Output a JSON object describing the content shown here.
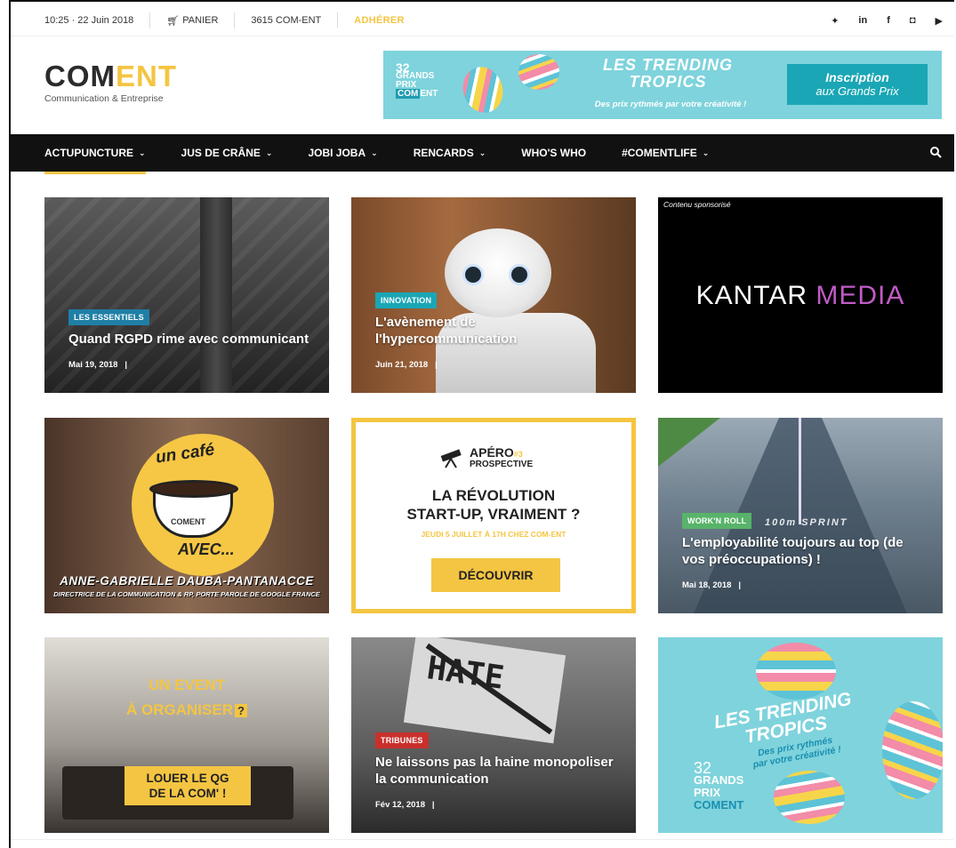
{
  "topbar": {
    "datetime": "10:25 · 22 Juin 2018",
    "cart": "PANIER",
    "minitel": "3615 COM-ENT",
    "join": "ADHÉRER",
    "socials": [
      "twitter-icon",
      "linkedin-icon",
      "facebook-icon",
      "instagram-icon",
      "youtube-icon"
    ],
    "social_glyphs": [
      "✦",
      "in",
      "f",
      "◘",
      "▶"
    ]
  },
  "logo": {
    "com": "COM",
    "ent": "ENT",
    "subtitle": "Communication & Entreprise"
  },
  "banner": {
    "gp_number": "32",
    "gp_line1": "GRANDS",
    "gp_line2": "PRIX",
    "gp_com": "COM",
    "gp_ent": "ENT",
    "title_line1": "LES TRENDING",
    "title_line2": "TROPICS",
    "tagline": "Des prix rythmés par votre créativité !",
    "cta_line1": "Inscription",
    "cta_line2": "aux Grands Prix"
  },
  "nav": {
    "items": [
      {
        "label": "ACTUPUNCTURE",
        "dropdown": true
      },
      {
        "label": "JUS DE CRÂNE",
        "dropdown": true
      },
      {
        "label": "JOBI JOBA",
        "dropdown": true
      },
      {
        "label": "RENCARDS",
        "dropdown": true
      },
      {
        "label": "WHO'S WHO",
        "dropdown": false
      },
      {
        "label": "#COMENTLIFE",
        "dropdown": true
      }
    ],
    "chevron": "⌄"
  },
  "cards": {
    "c1": {
      "badge": "LES ESSENTIELS",
      "title": "Quand RGPD rime avec communicant",
      "date": "Mai 19, 2018",
      "sep": "|"
    },
    "c2": {
      "badge": "INNOVATION",
      "title": "L'avènement de l'hypercommunication",
      "date": "Juin 21, 2018",
      "sep": "|"
    },
    "c3": {
      "sponsor": "Contenu sponsorisé",
      "brand1": "KANTAR",
      "brand2": "MEDIA"
    },
    "c4": {
      "un_cafe": "un café",
      "cup_label": "COMENT",
      "avec": "AVEC...",
      "name": "ANNE-GABRIELLE DAUBA-PANTANACCE",
      "role": "DIRECTRICE DE LA COMMUNICATION & RP, PORTE PAROLE DE GOOGLE FRANCE"
    },
    "c5": {
      "apero": "APÉRO",
      "apero_num": "#3",
      "prospective": "PROSPECTIVE",
      "headline1": "LA RÉVOLUTION",
      "headline2": "START-UP, VRAIMENT ?",
      "when": "JEUDI 5 JUILLET À 17H CHEZ COM-ENT",
      "button": "DÉCOUVRIR"
    },
    "c6": {
      "badge": "WORK'N ROLL",
      "title": "L'employabilité toujours au top (de vos préoccupations) !",
      "date": "Mai 18, 2018",
      "sep": "|",
      "track_text": "100m SPRINT"
    },
    "c7": {
      "line1": "UN EVENT",
      "line2": "À ORGANISER",
      "qmark": "?",
      "cta1": "LOUER LE QG",
      "cta2": "DE LA COM' !"
    },
    "c8": {
      "badge": "TRIBUNES",
      "title": "Ne laissons pas la haine monopoliser la communication",
      "date": "Fév 12, 2018",
      "sep": "|",
      "sign": "HATE"
    },
    "c9": {
      "title1": "LES TRENDING",
      "title2": "TROPICS",
      "tag1": "Des prix rythmés",
      "tag2": "par votre créativité !",
      "gp_number": "32",
      "gp1": "GRANDS",
      "gp2": "PRIX",
      "gp_com": "COMENT"
    }
  },
  "colors": {
    "accent": "#f4c542",
    "badge_blue": "#1f7fa6",
    "badge_teal": "#1aa6b5",
    "badge_green": "#58b36a",
    "badge_red": "#c9302c"
  }
}
